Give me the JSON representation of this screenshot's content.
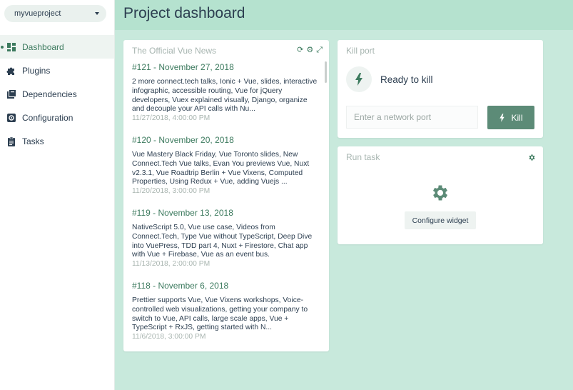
{
  "project": {
    "name": "myvueproject"
  },
  "header": {
    "title": "Project dashboard"
  },
  "sidebar": {
    "items": [
      {
        "label": "Dashboard",
        "icon": "dashboard-icon",
        "active": true
      },
      {
        "label": "Plugins",
        "icon": "puzzle-icon",
        "active": false
      },
      {
        "label": "Dependencies",
        "icon": "library-icon",
        "active": false
      },
      {
        "label": "Configuration",
        "icon": "settings-icon",
        "active": false
      },
      {
        "label": "Tasks",
        "icon": "assignment-icon",
        "active": false
      }
    ]
  },
  "colors": {
    "accent": "#3c7a5e",
    "header_bg": "#b5e2cf",
    "page_bg": "#c8e9dc",
    "kill_button": "#5c8b77"
  },
  "news": {
    "title": "The Official Vue News",
    "tools": [
      "refresh-icon",
      "gear-icon",
      "fullscreen-icon"
    ],
    "items": [
      {
        "title": "#121 - November 27, 2018",
        "description": "2 more connect.tech talks, Ionic + Vue, slides, interactive infographic, accessible routing, Vue for jQuery developers, Vuex explained visually, Django, organize and decouple your API calls with Nu...",
        "date": "11/27/2018, 4:00:00 PM"
      },
      {
        "title": "#120 - November 20, 2018",
        "description": "Vue Mastery Black Friday, Vue Toronto slides, New Connect.Tech Vue talks, Evan You previews Vue, Nuxt v2.3.1, Vue Roadtrip Berlin + Vue Vixens, Computed Properties, Using Redux + Vue, adding Vuejs ...",
        "date": "11/20/2018, 3:00:00 PM"
      },
      {
        "title": "#119 - November 13, 2018",
        "description": "NativeScript 5.0, Vue use case, Videos from Connect.Tech, Type Vue without TypeScript, Deep Dive into VuePress, TDD part 4, Nuxt + Firestore, Chat app with Vue + Firebase, Vue as an event bus.",
        "date": "11/13/2018, 2:00:00 PM"
      },
      {
        "title": "#118 - November 6, 2018",
        "description": "Prettier supports Vue, Vue Vixens workshops, Voice-controlled web visualizations, getting your company to switch to Vue, API calls, large scale apps, Vue + TypeScript + RxJS, getting started with N...",
        "date": "11/6/2018, 3:00:00 PM"
      }
    ]
  },
  "kill_port": {
    "title": "Kill port",
    "status": "Ready to kill",
    "input_placeholder": "Enter a network port",
    "button_label": "Kill"
  },
  "run_task": {
    "title": "Run task",
    "button_label": "Configure widget"
  }
}
